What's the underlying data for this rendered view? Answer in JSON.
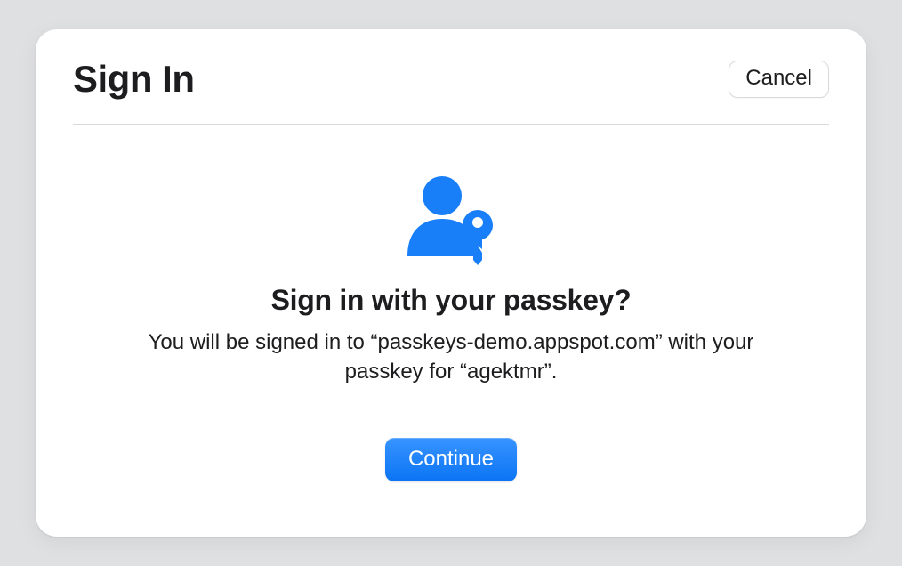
{
  "header": {
    "title": "Sign In",
    "cancel_label": "Cancel"
  },
  "content": {
    "icon_name": "passkey-icon",
    "icon_color": "#187ff9",
    "headline": "Sign in with your passkey?",
    "body_text": "You will be signed in to “passkeys-demo.appspot.com” with your passkey for “agektmr”.",
    "continue_label": "Continue"
  }
}
